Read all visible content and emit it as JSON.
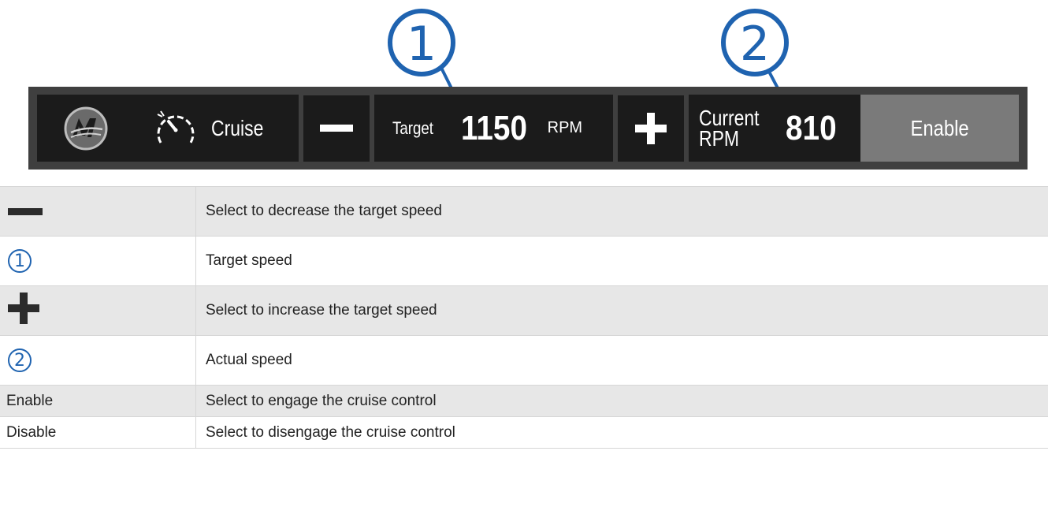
{
  "callouts": [
    {
      "number": "1"
    },
    {
      "number": "2"
    }
  ],
  "bar": {
    "logo_icon": "mercury-logo-icon",
    "cruise_icon": "speedometer-icon",
    "cruise_label": "Cruise",
    "decrease_icon": "minus-icon",
    "target_label": "Target",
    "target_value": "1150",
    "target_unit": "RPM",
    "increase_icon": "plus-icon",
    "current_label": "Current RPM",
    "current_value": "810",
    "enable_label": "Enable"
  },
  "legend": {
    "rows": [
      {
        "symbol": "minus-icon",
        "label": "",
        "description": "Select to decrease the target speed"
      },
      {
        "symbol": "callout-1-icon",
        "label": "1",
        "description": "Target speed"
      },
      {
        "symbol": "plus-icon",
        "label": "",
        "description": "Select to increase the target speed"
      },
      {
        "symbol": "callout-2-icon",
        "label": "2",
        "description": "Actual speed"
      },
      {
        "symbol": "",
        "label": "Enable",
        "description": "Select to engage the cruise control"
      },
      {
        "symbol": "",
        "label": "Disable",
        "description": "Select to disengage the cruise control"
      }
    ]
  },
  "colors": {
    "callout_blue": "#1f63b0",
    "bar_dark": "#1b1b1b",
    "bar_frame": "#3f3f3f",
    "enable_gray": "#7a7a7a",
    "row_shade": "#e7e7e7"
  }
}
